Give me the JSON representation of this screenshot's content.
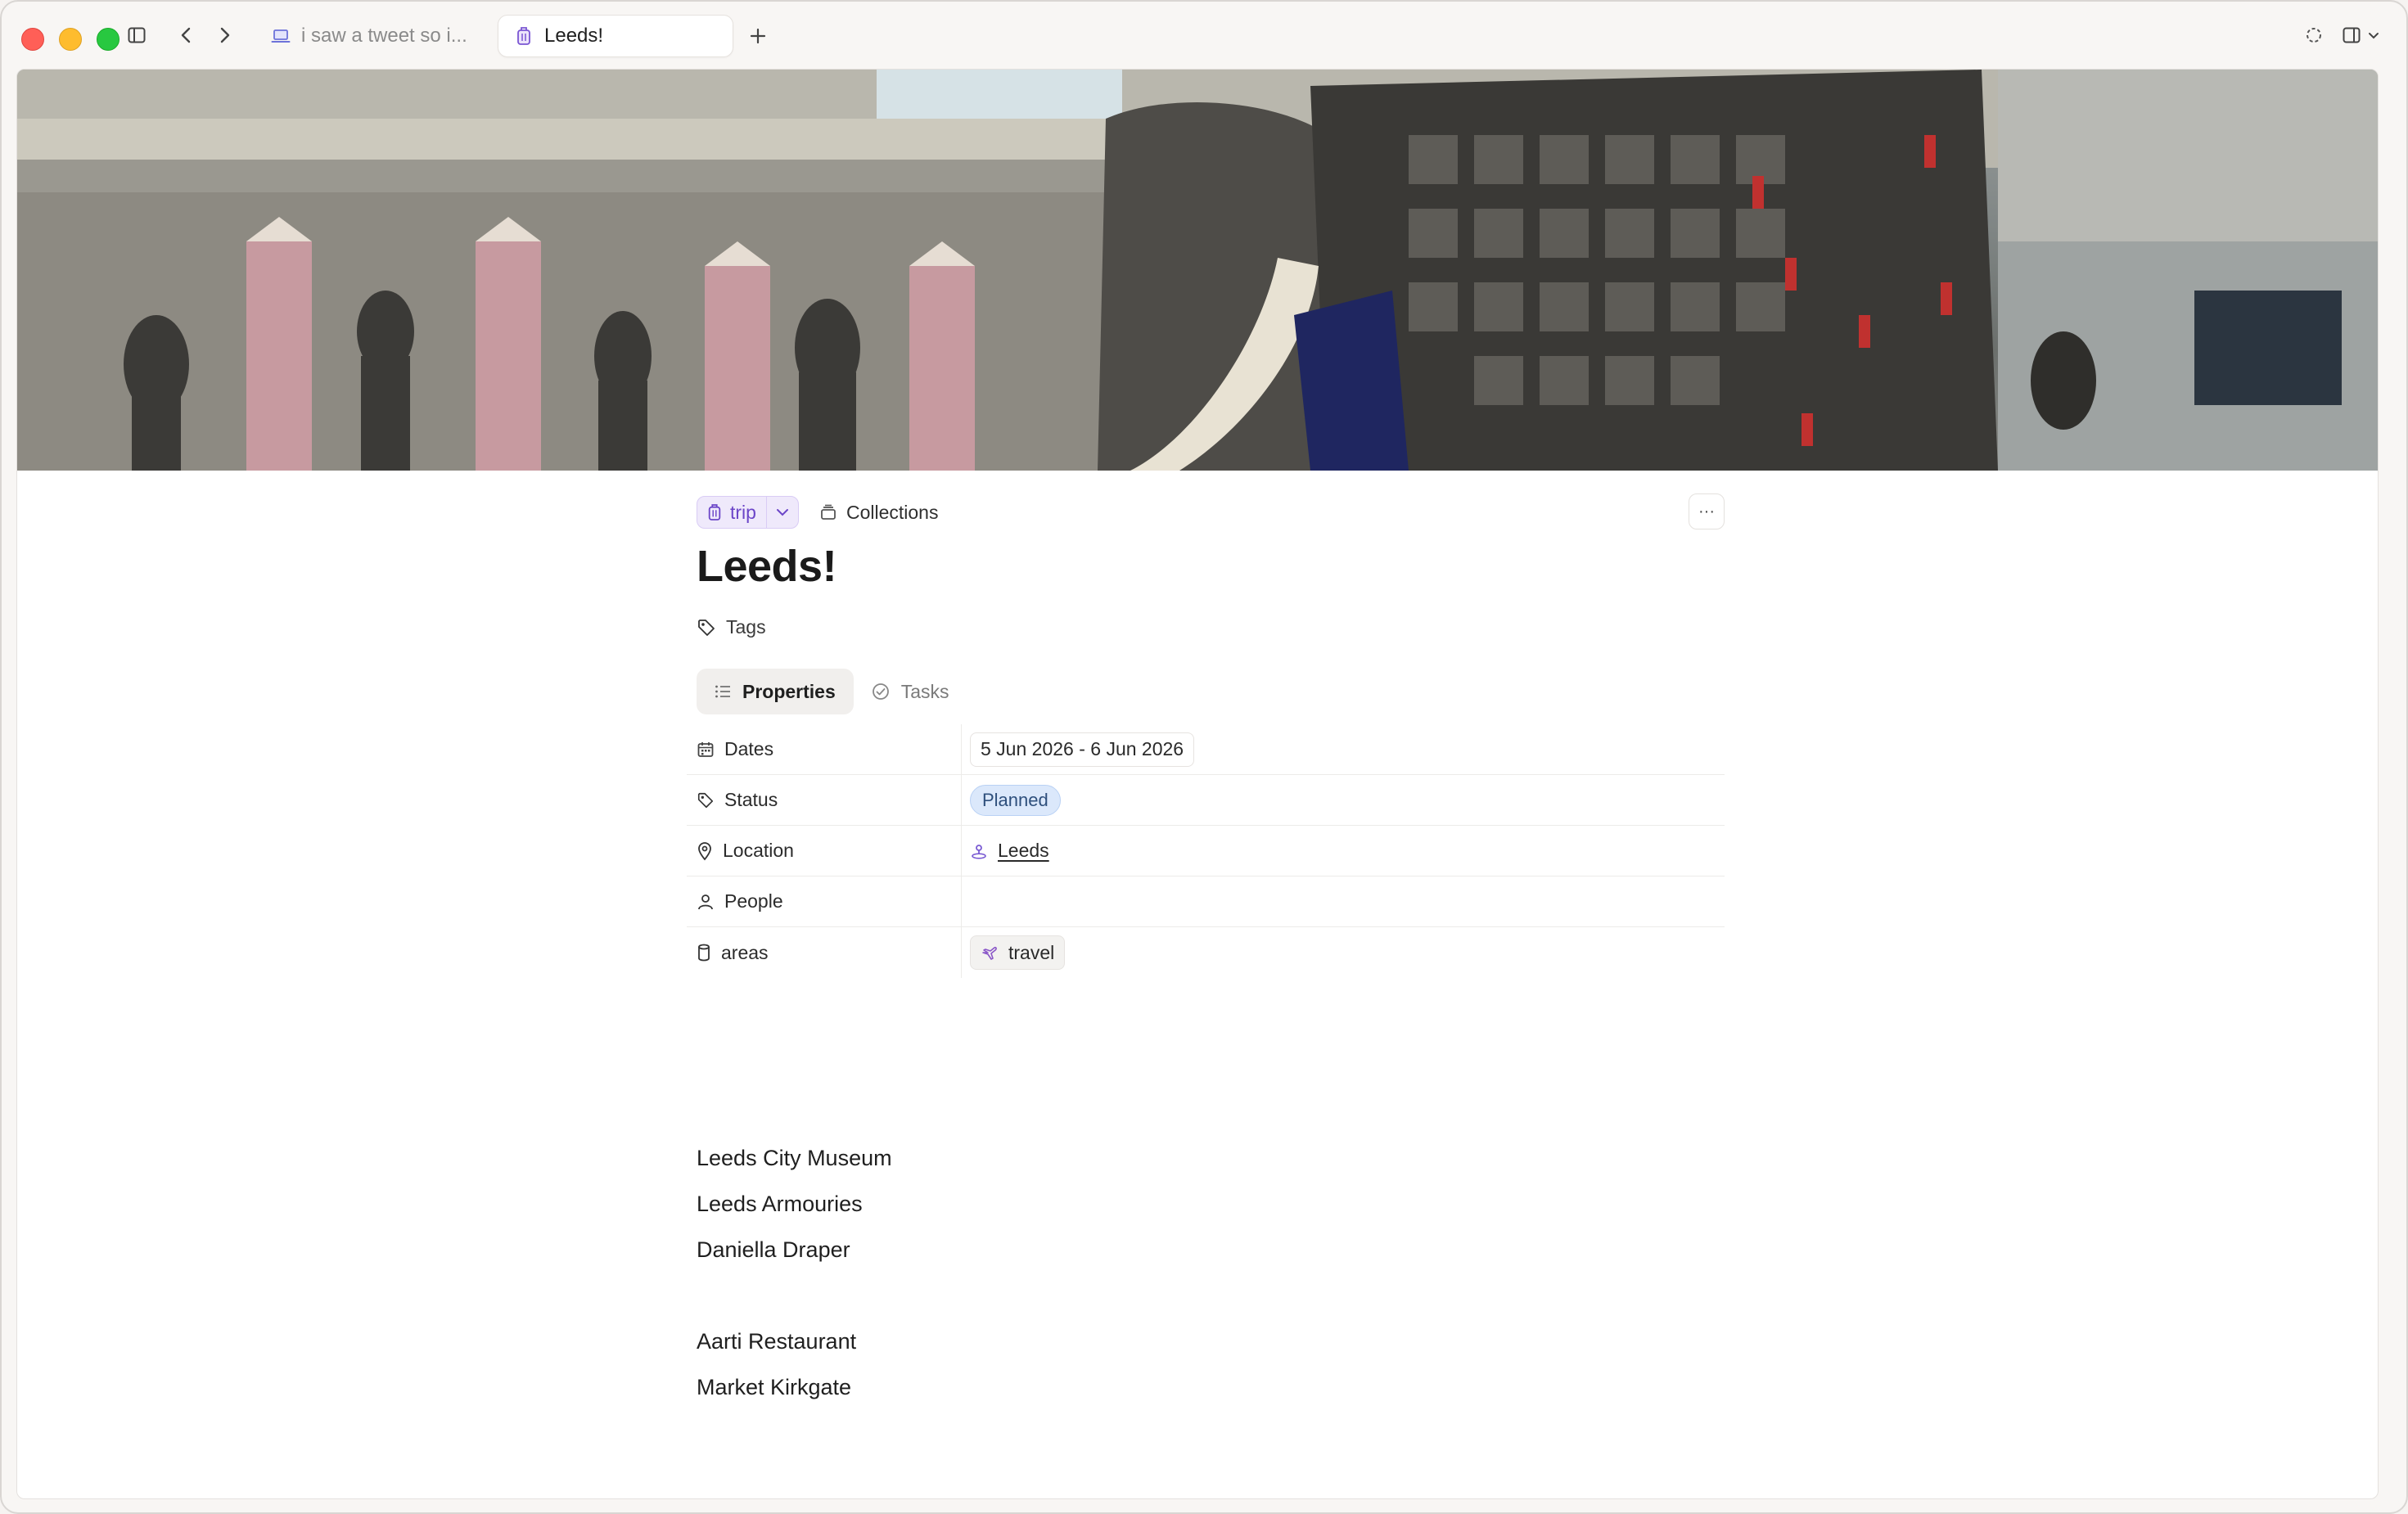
{
  "window": {
    "tabs": [
      {
        "label": "i saw a tweet so i...",
        "icon": "laptop-icon",
        "active": false
      },
      {
        "label": "Leeds!",
        "icon": "luggage-icon",
        "active": true
      }
    ]
  },
  "page": {
    "banner": {
      "alt": "museum-armour-photo"
    },
    "type_chip": {
      "label": "trip",
      "icon": "luggage-icon",
      "color": "#6b45c8"
    },
    "collections_label": "Collections",
    "more_label": "···",
    "title": "Leeds!",
    "tags_label": "Tags",
    "tabs": [
      {
        "label": "Properties",
        "icon": "list-icon",
        "active": true
      },
      {
        "label": "Tasks",
        "icon": "check-circle-icon",
        "active": false
      }
    ],
    "properties": {
      "dates": {
        "label": "Dates",
        "value": "5 Jun 2026 - 6 Jun 2026"
      },
      "status": {
        "label": "Status",
        "value": "Planned",
        "color": "#dbe8fb"
      },
      "location": {
        "label": "Location",
        "value": "Leeds"
      },
      "people": {
        "label": "People",
        "value": ""
      },
      "areas": {
        "label": "areas",
        "value": "travel"
      }
    },
    "body": {
      "group1": [
        "Leeds City Museum",
        "Leeds Armouries",
        "Daniella Draper"
      ],
      "group2": [
        "Aarti Restaurant",
        "Market Kirkgate"
      ]
    }
  }
}
